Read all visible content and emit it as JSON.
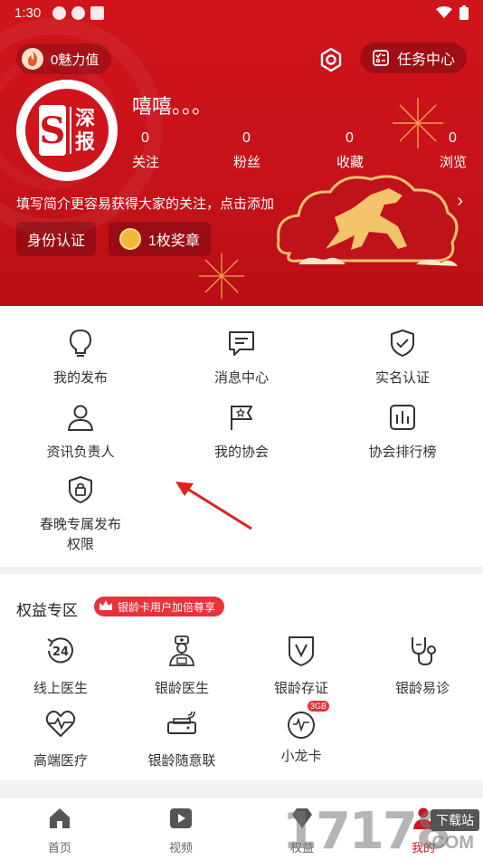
{
  "status_bar": {
    "time": "1:30"
  },
  "header": {
    "charm_label": "0魅力值",
    "task_center_label": "任务中心",
    "avatar_logo": {
      "letter": "S",
      "line1": "深",
      "line2": "报"
    },
    "nickname": "嘻嘻。。。",
    "stats": [
      {
        "value": "0",
        "label": "关注"
      },
      {
        "value": "0",
        "label": "粉丝"
      },
      {
        "value": "0",
        "label": "收藏"
      },
      {
        "value": "0",
        "label": "浏览"
      }
    ],
    "intro": "填写简介更容易获得大家的关注，点击添加",
    "id_button": "身份认证",
    "medal_button": "1枚奖章"
  },
  "menu": {
    "items": [
      {
        "label": "我的发布",
        "icon": "bulb-icon"
      },
      {
        "label": "消息中心",
        "icon": "message-icon"
      },
      {
        "label": "实名认证",
        "icon": "shield-check-icon"
      },
      {
        "label": "资讯负责人",
        "icon": "person-icon"
      },
      {
        "label": "我的协会",
        "icon": "flag-star-icon"
      },
      {
        "label": "协会排行榜",
        "icon": "bar-chart-icon"
      },
      {
        "label": "春晚专属发布权限",
        "icon": "lock-shield-icon"
      }
    ]
  },
  "rights": {
    "title": "权益专区",
    "badge": "银龄卡用户加倍尊享",
    "items": [
      {
        "label": "线上医生",
        "icon": "24h-icon"
      },
      {
        "label": "银龄医生",
        "icon": "doctor-icon"
      },
      {
        "label": "银龄存证",
        "icon": "shield-v-icon"
      },
      {
        "label": "银龄易诊",
        "icon": "stethoscope-icon"
      },
      {
        "label": "高端医疗",
        "icon": "heart-pulse-icon"
      },
      {
        "label": "银龄随意联",
        "icon": "router-icon"
      },
      {
        "label": "小龙卡",
        "icon": "data-card-icon",
        "tag": "3GB"
      }
    ]
  },
  "bottom_nav": {
    "items": [
      {
        "label": "首页",
        "icon": "home-icon"
      },
      {
        "label": "视频",
        "icon": "video-play-icon"
      },
      {
        "label": "权益",
        "icon": "diamond-icon"
      },
      {
        "label": "我的",
        "icon": "person-icon"
      }
    ]
  },
  "watermark": {
    "number": "17178",
    "box": "下载站",
    "suffix": ".COM"
  },
  "colors": {
    "primary": "#d0141b",
    "badge": "#e8323a",
    "text": "#333333",
    "bg": "#f2f2f2",
    "gold": "#f5b73b"
  }
}
